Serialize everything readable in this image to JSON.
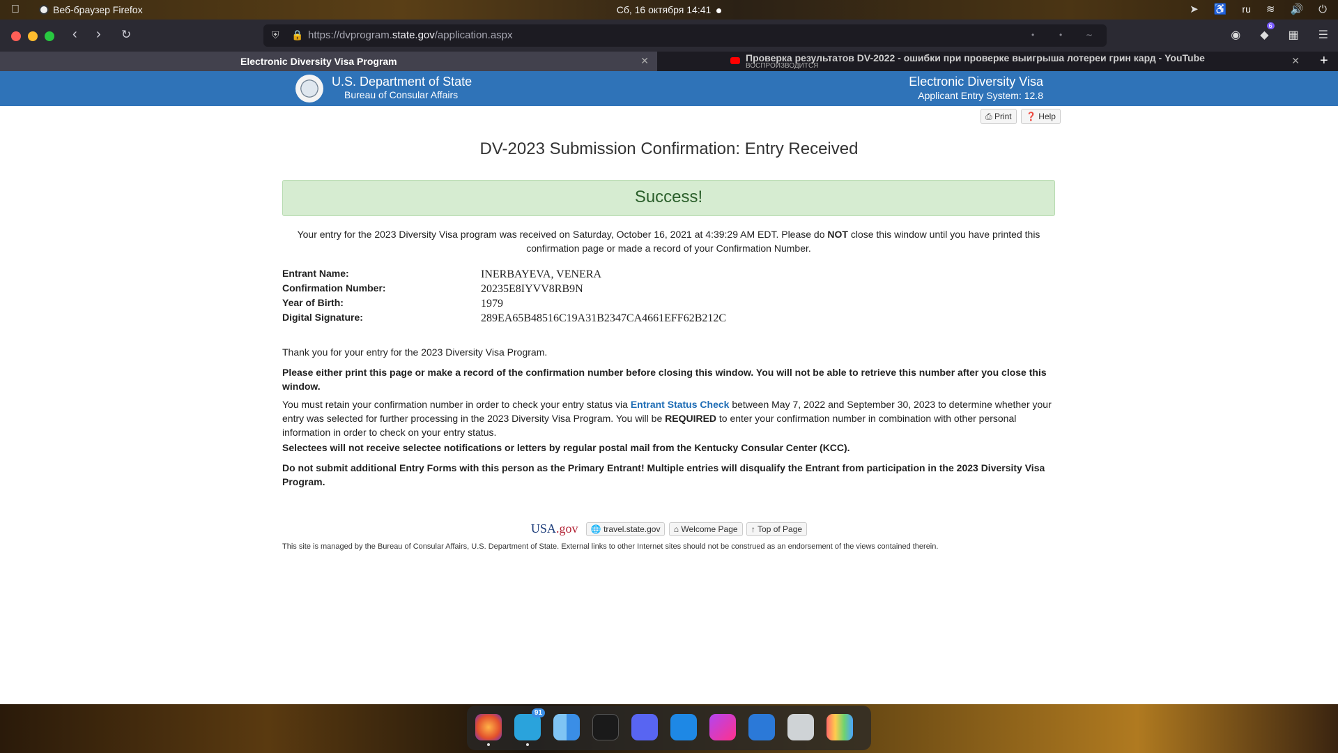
{
  "system": {
    "browser_name": "Веб-браузер Firefox",
    "clock": "Сб, 16 октября  14:41",
    "lang": "ru"
  },
  "browser": {
    "url_prefix": "https://dvprogram.",
    "url_domain": "state.gov",
    "url_path": "/application.aspx",
    "tabs": [
      {
        "title": "Electronic Diversity Visa Program"
      },
      {
        "title": "Проверка результатов DV-2022 - ошибки при проверке выигрыша лотереи грин кард - YouTube",
        "subtitle": "ВОСПРОИЗВОДИТСЯ"
      }
    ],
    "extension_badge": "6"
  },
  "header": {
    "dept": "U.S. Department of State",
    "bureau": "Bureau of Consular Affairs",
    "system_name": "Electronic Diversity Visa",
    "version": "Applicant Entry System: 12.8"
  },
  "actions": {
    "print": "Print",
    "help": "Help"
  },
  "main": {
    "title": "DV-2023 Submission Confirmation: Entry Received",
    "success": "Success!",
    "intro_1": "Your entry for the 2023 Diversity Visa program was received on Saturday, October 16, 2021 at 4:39:29 AM EDT. Please do ",
    "intro_not": "NOT",
    "intro_2": " close this window until you have printed this confirmation page or made a record of your Confirmation Number.",
    "fields": [
      {
        "label": "Entrant Name:",
        "value": "INERBAYEVA, VENERA"
      },
      {
        "label": "Confirmation Number:",
        "value": "20235E8IYVV8RB9N"
      },
      {
        "label": "Year of Birth:",
        "value": "1979"
      },
      {
        "label": "Digital Signature:",
        "value": "289EA65B48516C19A31B2347CA4661EFF62B212C"
      }
    ],
    "thanks": "Thank you for your entry for the 2023 Diversity Visa Program.",
    "print_warning": "Please either print this page or make a record of the confirmation number before closing this window. You will not be able to retrieve this number after you close this window.",
    "retain_1": "You must retain your confirmation number in order to check your entry status via ",
    "retain_link": "Entrant Status Check",
    "retain_2": " between May 7, 2022 and September 30, 2023 to determine whether your entry was selected for further processing in the 2023 Diversity Visa Program. You will be ",
    "retain_required": "REQUIRED",
    "retain_3": " to enter your confirmation number in combination with other personal information in order to check on your entry status.",
    "selectees": "Selectees will not receive selectee notifications or letters by regular postal mail from the Kentucky Consular Center (KCC).",
    "no_submit": "Do not submit additional Entry Forms with this person as the Primary Entrant! Multiple entries will disqualify the Entrant from participation in the 2023 Diversity Visa Program."
  },
  "footer": {
    "usagov_a": "USA",
    "usagov_b": ".gov",
    "travel": "travel.state.gov",
    "welcome": "Welcome Page",
    "top": "Top of Page",
    "disclaimer": "This site is managed by the Bureau of Consular Affairs, U.S. Department of State. External links to other Internet sites should not be construed as an endorsement of the views contained therein."
  },
  "dock": {
    "telegram_badge": "91",
    "apps": [
      "firefox-icon",
      "telegram-icon",
      "finder-icon",
      "terminal-icon",
      "discord-icon",
      "vscode-icon",
      "phpstorm-icon",
      "text-editor-icon",
      "trash-icon",
      "app-grid-icon"
    ]
  }
}
